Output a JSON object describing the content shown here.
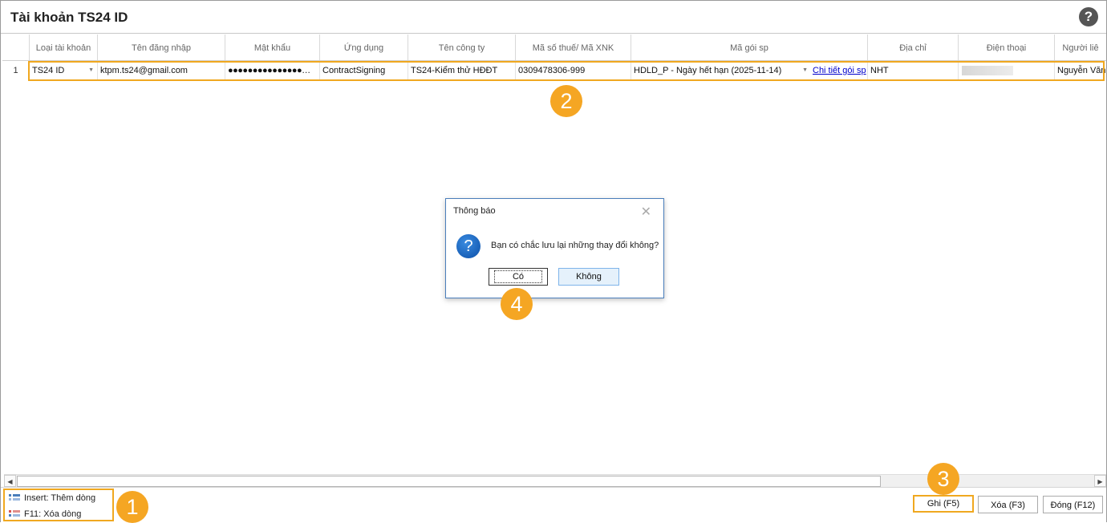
{
  "window": {
    "title": "Tài khoản TS24 ID",
    "help_symbol": "?"
  },
  "table": {
    "columns": [
      "Loại tài khoản",
      "Tên đăng nhập",
      "Mật khẩu",
      "Ứng dụng",
      "Tên công ty",
      "Mã số thuế/ Mã XNK",
      "Mã gói sp",
      "Địa chỉ",
      "Điện thoại",
      "Người liê"
    ],
    "rows": [
      {
        "index": "1",
        "account_type": "TS24 ID",
        "username": "ktpm.ts24@gmail.com",
        "password": "●●●●●●●●●●●●●●●…",
        "app": "ContractSigning",
        "company": "TS24-Kiểm thử HĐĐT",
        "tax_code": "0309478306-999",
        "package": "HDLD_P - Ngày hết hạn (2025-11-14)",
        "package_link": "Chi tiết gói sp",
        "address": "NHT",
        "phone": "",
        "contact": "Nguyễn Văn"
      }
    ]
  },
  "dialog": {
    "title": "Thông báo",
    "close_symbol": "✕",
    "icon_symbol": "?",
    "message": "Bạn có chắc lưu lại những thay đổi không?",
    "yes_label": "Có",
    "no_label": "Không"
  },
  "footer": {
    "insert_hint": "Insert: Thêm dòng",
    "delete_hint": "F11: Xóa dòng",
    "save_label": "Ghi (F5)",
    "delete_label": "Xóa (F3)",
    "close_label": "Đóng (F12)"
  },
  "badges": [
    "1",
    "2",
    "3",
    "4"
  ],
  "colors": {
    "highlight": "#f0a820",
    "badge": "#f5a623",
    "dialog_border": "#4a7ebb",
    "link": "#0000cc"
  },
  "icons": {
    "help": "help-circle-icon",
    "dropdown": "chevron-down-icon",
    "question": "question-icon",
    "close": "close-icon",
    "insert": "insert-row-icon",
    "delete": "delete-row-icon"
  }
}
